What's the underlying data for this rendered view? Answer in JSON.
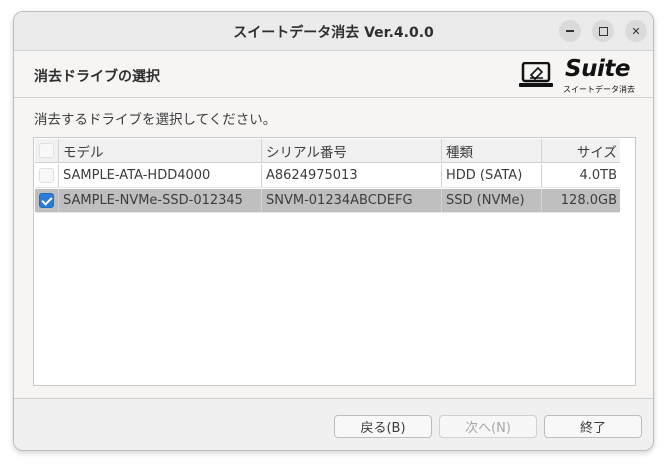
{
  "window": {
    "title": "スイートデータ消去 Ver.4.0.0",
    "close_glyph": "✕"
  },
  "header": {
    "title": "消去ドライブの選択",
    "logo_word": "Suite",
    "logo_sub": "スイートデータ消去"
  },
  "instruction": "消去するドライブを選択してください。",
  "table": {
    "columns": [
      "モデル",
      "シリアル番号",
      "種類",
      "サイズ"
    ],
    "rows": [
      {
        "checked": false,
        "model": "SAMPLE-ATA-HDD4000",
        "serial": "A8624975013",
        "type": "HDD (SATA)",
        "size": "4.0TB"
      },
      {
        "checked": true,
        "model": "SAMPLE-NVMe-SSD-012345",
        "serial": "SNVM-01234ABCDEFG",
        "type": "SSD (NVMe)",
        "size": "128.0GB"
      }
    ]
  },
  "buttons": {
    "back": "戻る(B)",
    "next": "次へ(N)",
    "finish": "終了"
  }
}
